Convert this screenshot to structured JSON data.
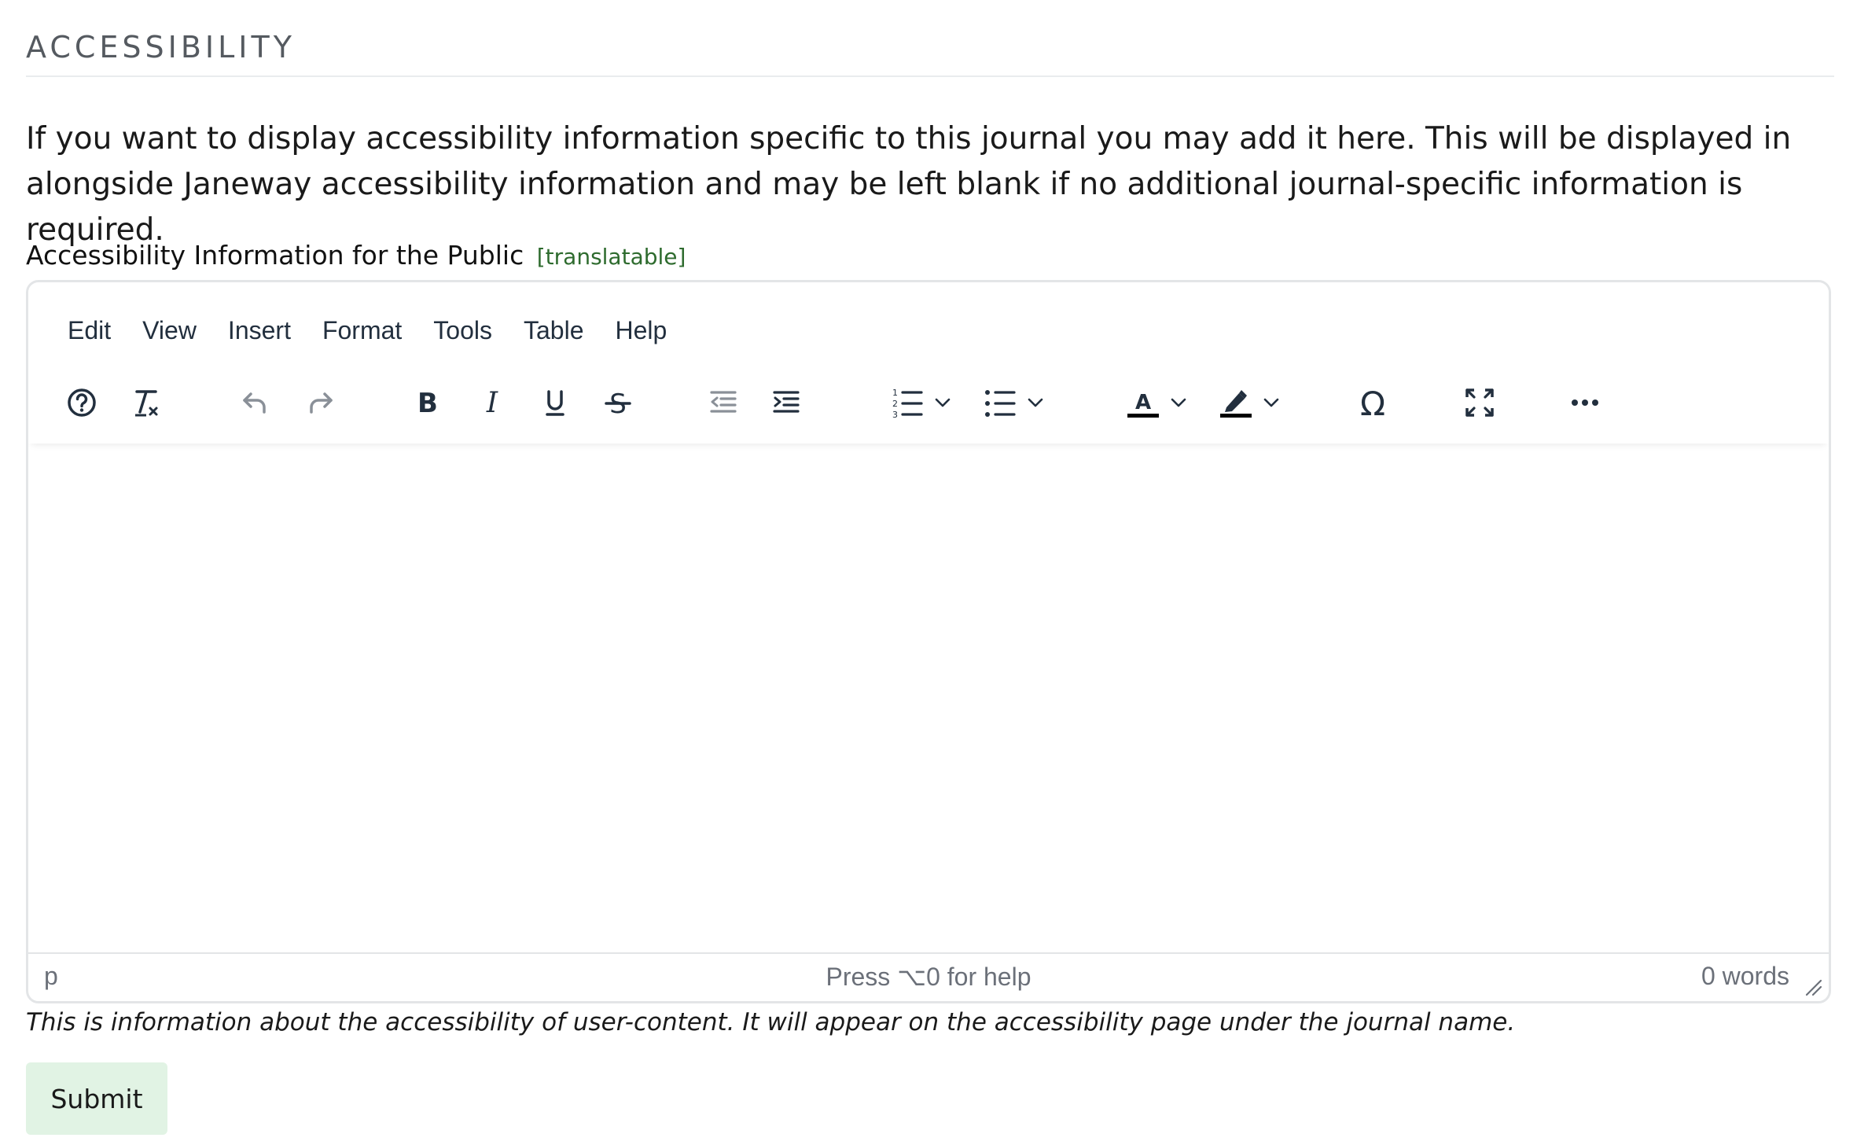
{
  "section": {
    "title": "ACCESSIBILITY",
    "intro": "If you want to display accessibility information specific to this journal you may add it here. This will be displayed in alongside Janeway accessibility information and may be left blank if no additional journal-specific information is required."
  },
  "field": {
    "label": "Accessibility Information for the Public",
    "tag": "[translatable]",
    "help": "This is information about the accessibility of user-content. It will appear on the accessibility page under the journal name."
  },
  "editor": {
    "menu": [
      "Edit",
      "View",
      "Insert",
      "Format",
      "Tools",
      "Table",
      "Help"
    ],
    "toolbar_icons": [
      "help-icon",
      "clear-formatting-icon",
      "undo-icon",
      "redo-icon",
      "bold-icon",
      "italic-icon",
      "underline-icon",
      "strikethrough-icon",
      "outdent-icon",
      "indent-icon",
      "numbered-list-icon",
      "bullet-list-icon",
      "text-color-icon",
      "highlight-color-icon",
      "special-character-icon",
      "fullscreen-icon",
      "more-icon"
    ],
    "colors": {
      "icon": "#222f3e",
      "icon_disabled": "#8a9098"
    },
    "status": {
      "path": "p",
      "help": "Press ⌥0 for help",
      "words": "0 words"
    }
  },
  "actions": {
    "submit_label": "Submit",
    "submit_color": "#e1f3e4"
  }
}
